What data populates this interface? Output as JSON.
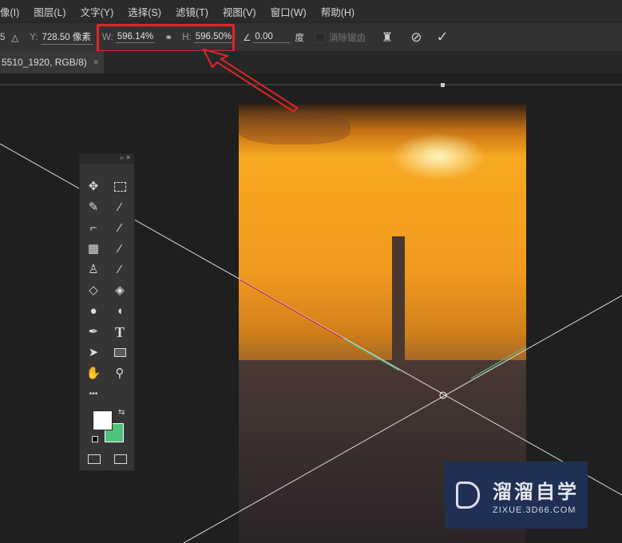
{
  "menu": [
    "像(I)",
    "图层(L)",
    "文字(Y)",
    "选择(S)",
    "滤镜(T)",
    "视图(V)",
    "窗口(W)",
    "帮助(H)"
  ],
  "options": {
    "y_label": "Y:",
    "y_value": "728.50 像素",
    "w_label": "W:",
    "w_value": "596.14%",
    "h_label": "H:",
    "h_value": "596.50%",
    "angle_value": "0.00",
    "angle_unit": "度",
    "antialias_label": "消除锯齿",
    "prefix": "5"
  },
  "document_tab": {
    "title": "5510_1920, RGB/8)",
    "close": "×"
  },
  "colors": {
    "foreground": "#ffffff",
    "background": "#4fc27a",
    "highlight": "#e0262a"
  },
  "watermark": {
    "title": "溜溜自学",
    "url": "ZIXUE.3D66.COM"
  },
  "tools": [
    "move",
    "marquee",
    "lasso",
    "magic-wand",
    "crop",
    "eyedropper",
    "healing",
    "brush",
    "stamp",
    "history-brush",
    "eraser",
    "paint-bucket",
    "blur",
    "dodge",
    "pen",
    "type",
    "path-select",
    "rectangle",
    "hand",
    "zoom",
    "more"
  ],
  "type_tool_glyph": "T",
  "more_glyph": "•••"
}
